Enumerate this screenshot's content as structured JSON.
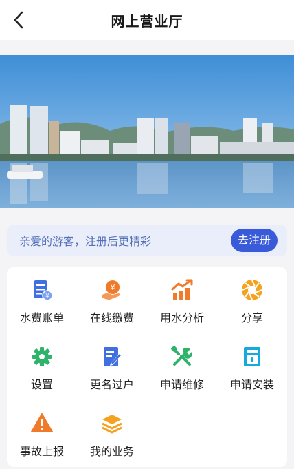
{
  "header": {
    "title": "网上营业厅"
  },
  "notice": {
    "text": "亲爱的游客，注册后更精彩",
    "button_label": "去注册"
  },
  "menu": {
    "items": [
      {
        "label": "水费账单",
        "icon": "water-bill-icon"
      },
      {
        "label": "在线缴费",
        "icon": "online-payment-icon"
      },
      {
        "label": "用水分析",
        "icon": "usage-analysis-icon"
      },
      {
        "label": "分享",
        "icon": "share-icon"
      },
      {
        "label": "设置",
        "icon": "settings-icon"
      },
      {
        "label": "更名过户",
        "icon": "rename-transfer-icon"
      },
      {
        "label": "申请维修",
        "icon": "repair-request-icon"
      },
      {
        "label": "申请安装",
        "icon": "installation-request-icon"
      },
      {
        "label": "事故上报",
        "icon": "incident-report-icon"
      },
      {
        "label": "我的业务",
        "icon": "my-business-icon"
      }
    ]
  },
  "colors": {
    "accent": "#3a5bd9",
    "blue_icon": "#3f6fe0",
    "orange_icon": "#f07a2a",
    "green_icon": "#2fb36b",
    "cyan_icon": "#16a9e0",
    "notice_bg": "#e9eefa"
  }
}
